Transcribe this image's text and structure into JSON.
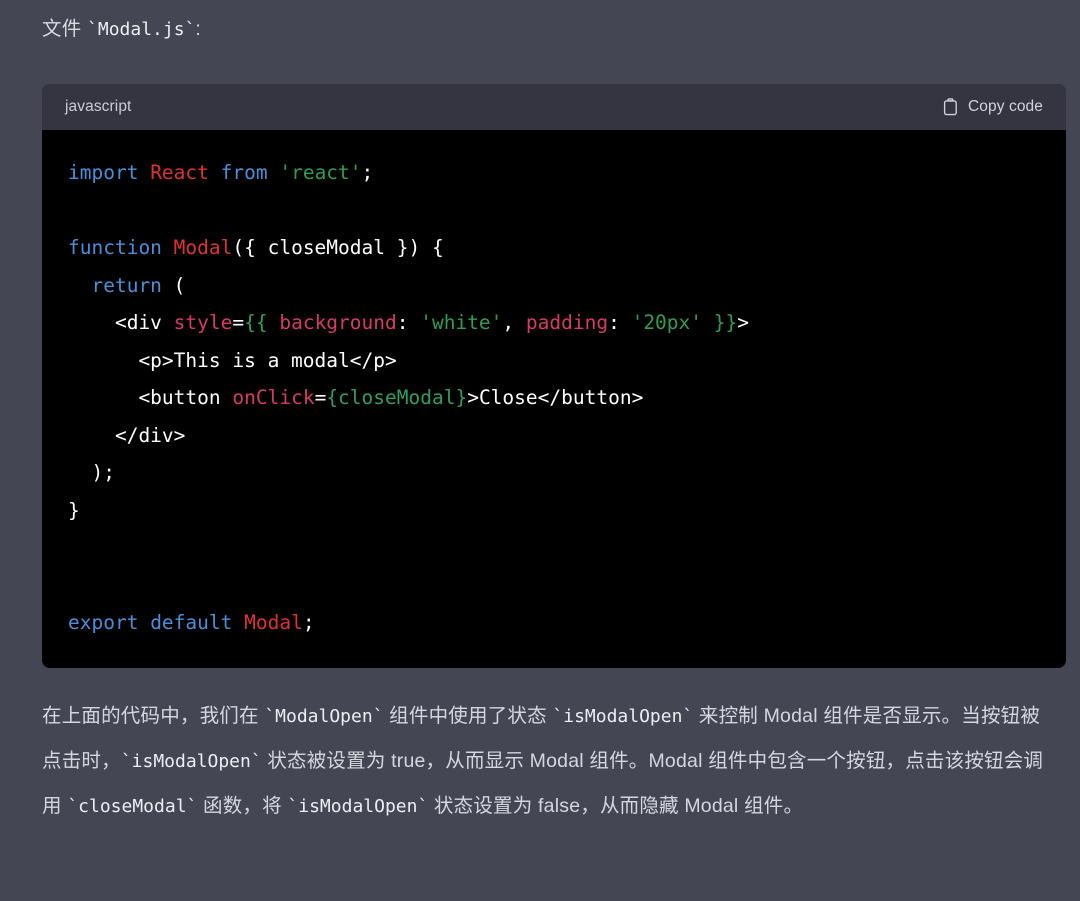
{
  "intro": {
    "prefix": "文件 ",
    "code_ref": "`Modal.js`",
    "suffix": ":"
  },
  "code_block": {
    "language_label": "javascript",
    "copy_label": "Copy code",
    "copy_icon": "clipboard-icon",
    "colors": {
      "background": "#000000",
      "header_background": "#343541",
      "keyword": "#4a90d9",
      "identifier": "#e03131",
      "string": "#2e9e55",
      "attribute": "#d73a67",
      "brace": "#2f9e63",
      "plain": "#ffffff"
    },
    "lines": [
      [
        {
          "t": "import ",
          "c": "kw"
        },
        {
          "t": "React ",
          "c": "id"
        },
        {
          "t": "from ",
          "c": "kw"
        },
        {
          "t": "'react'",
          "c": "str"
        },
        {
          "t": ";",
          "c": "plain"
        }
      ],
      [],
      [
        {
          "t": "function ",
          "c": "kw"
        },
        {
          "t": "Modal",
          "c": "id"
        },
        {
          "t": "({ closeModal }) {",
          "c": "plain"
        }
      ],
      [
        {
          "t": "  ",
          "c": "plain"
        },
        {
          "t": "return",
          "c": "kw"
        },
        {
          "t": " (",
          "c": "plain"
        }
      ],
      [
        {
          "t": "    <div ",
          "c": "plain"
        },
        {
          "t": "style",
          "c": "attr"
        },
        {
          "t": "=",
          "c": "plain"
        },
        {
          "t": "{{",
          "c": "brace"
        },
        {
          "t": " background",
          "c": "attr"
        },
        {
          "t": ": ",
          "c": "plain"
        },
        {
          "t": "'white'",
          "c": "str"
        },
        {
          "t": ", ",
          "c": "plain"
        },
        {
          "t": "padding",
          "c": "attr"
        },
        {
          "t": ": ",
          "c": "plain"
        },
        {
          "t": "'20px'",
          "c": "str"
        },
        {
          "t": " ",
          "c": "plain"
        },
        {
          "t": "}}",
          "c": "brace"
        },
        {
          "t": ">",
          "c": "plain"
        }
      ],
      [
        {
          "t": "      <p>This is a modal</p>",
          "c": "plain"
        }
      ],
      [
        {
          "t": "      <button ",
          "c": "plain"
        },
        {
          "t": "onClick",
          "c": "attr"
        },
        {
          "t": "=",
          "c": "plain"
        },
        {
          "t": "{closeModal}",
          "c": "brace"
        },
        {
          "t": ">Close</button>",
          "c": "plain"
        }
      ],
      [
        {
          "t": "    </div>",
          "c": "plain"
        }
      ],
      [
        {
          "t": "  );",
          "c": "plain"
        }
      ],
      [
        {
          "t": "}",
          "c": "plain"
        }
      ],
      [],
      [],
      [
        {
          "t": "export ",
          "c": "kw"
        },
        {
          "t": "default ",
          "c": "kw"
        },
        {
          "t": "Modal",
          "c": "id"
        },
        {
          "t": ";",
          "c": "plain"
        }
      ]
    ]
  },
  "explanation": {
    "segments": [
      {
        "t": "在上面的代码中，我们在 ",
        "mono": false
      },
      {
        "t": "`ModalOpen`",
        "mono": true
      },
      {
        "t": " 组件中使用了状态 ",
        "mono": false
      },
      {
        "t": "`isModalOpen`",
        "mono": true
      },
      {
        "t": " 来控制 Modal 组件是否显示。当按钮被点击时，",
        "mono": false
      },
      {
        "t": "`isModalOpen`",
        "mono": true
      },
      {
        "t": " 状态被设置为 true，从而显示 Modal 组件。Modal 组件中包含一个按钮，点击该按钮会调用 ",
        "mono": false
      },
      {
        "t": "`closeModal`",
        "mono": true
      },
      {
        "t": " 函数，将 ",
        "mono": false
      },
      {
        "t": "`isModalOpen`",
        "mono": true
      },
      {
        "t": " 状态设置为 false，从而隐藏 Modal 组件。",
        "mono": false
      }
    ]
  }
}
